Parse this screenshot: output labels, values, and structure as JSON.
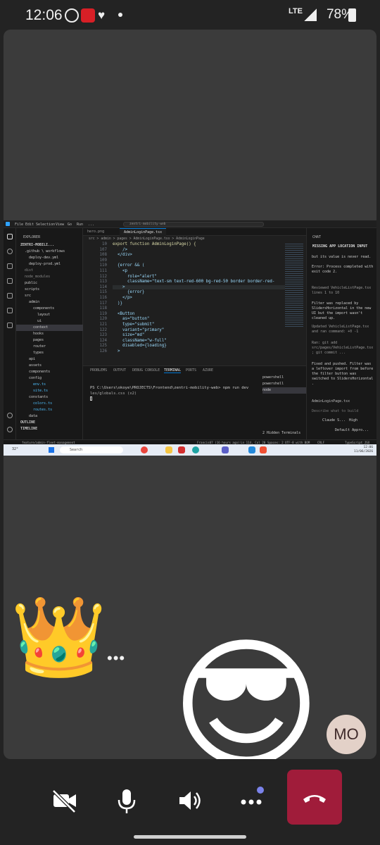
{
  "status_bar": {
    "time": "12:06",
    "network": "LTE",
    "battery": "78%",
    "icons": [
      "whatsapp-icon",
      "smart-cash-icon",
      "heart-icon",
      "dot-icon",
      "lte-icon",
      "signal-icon",
      "battery-icon"
    ]
  },
  "vscode": {
    "menu": [
      "File",
      "Edit",
      "Selection",
      "View",
      "Go",
      "Run",
      "..."
    ],
    "search_placeholder": "zentri-mobility-web",
    "explorer": {
      "title": "EXPLORER",
      "project": "ZENTRI-MOBILI...",
      "items": [
        ".github \\ workflows",
        "deploy-dev.yml",
        "deploy-prod.yml",
        "dist",
        "node_modules",
        "public",
        "scripts",
        "src",
        "admin",
        "components",
        "layout",
        "ui",
        "context",
        "hooks",
        "pages",
        "router",
        "types",
        "api",
        "assets",
        "components",
        "config",
        "env.ts",
        "site.ts",
        "constants",
        "colors.ts",
        "routes.ts",
        "data"
      ],
      "sections": [
        "OUTLINE",
        "TIMELINE"
      ]
    },
    "tabs": [
      "hero.png",
      "AdminLoginPage.tsx"
    ],
    "breadcrumb": "src > admin > pages > AdminLoginPage.tsx > AdminLoginPage",
    "code": [
      {
        "n": "10",
        "t": "export function AdminLoginPage() {"
      },
      {
        "n": "107",
        "t": "    />"
      },
      {
        "n": "108",
        "t": "  </div>"
      },
      {
        "n": "109",
        "t": ""
      },
      {
        "n": "110",
        "t": "  {error && ("
      },
      {
        "n": "111",
        "t": "    <p"
      },
      {
        "n": "112",
        "t": "      role=\"alert\""
      },
      {
        "n": "113",
        "t": "      className=\"text-sm text-red-600 bg-red-50 border border-red-"
      },
      {
        "n": "114",
        "t": "    >"
      },
      {
        "n": "115",
        "t": "      {error}"
      },
      {
        "n": "116",
        "t": "    </p>"
      },
      {
        "n": "117",
        "t": "  )}"
      },
      {
        "n": "118",
        "t": ""
      },
      {
        "n": "119",
        "t": "  <Button"
      },
      {
        "n": "120",
        "t": "    as=\"button\""
      },
      {
        "n": "121",
        "t": "    type=\"submit\""
      },
      {
        "n": "122",
        "t": "    variant=\"primary\""
      },
      {
        "n": "123",
        "t": "    size=\"md\""
      },
      {
        "n": "124",
        "t": "    className=\"w-full\""
      },
      {
        "n": "125",
        "t": "    disabled={loading}"
      },
      {
        "n": "126",
        "t": "  >"
      }
    ],
    "panel_tabs": [
      "PROBLEMS",
      "OUTPUT",
      "DEBUG CONSOLE",
      "TERMINAL",
      "PORTS",
      "AZURE"
    ],
    "terminal": [
      "PS C:\\Users\\okoye\\PROJECTS\\Frontend\\zentri-mobility-web> npm run dev",
      "les/globals.css (x2)"
    ],
    "terminals": [
      "powershell",
      "powershell",
      "node"
    ],
    "hidden_terminals": "2 Hidden Terminals",
    "chat": {
      "header": "CHAT",
      "title": "MISSING APP LOCATION INPUT",
      "messages": [
        "but its value is never read.",
        "Error: Process completed with exit code 2.",
        "Reviewed VehicleListPage.tsx lines 1 to 10",
        "Filter was replaced by SlidersHorizontal in the new UI but the import wasn't cleaned up.",
        "Updated VehicleListPage.tsx and ran command: +0 -1",
        "Ran: git add src/pages/VehicleListPage.tsx ; git commit ...",
        "Fixed and pushed. Filter was a leftover import from before the filter button was switched to SlidersHorizontal ."
      ],
      "file_chip": "AdminLoginPage.tsx",
      "input_placeholder": "Describe what to build",
      "model": "Claude S...",
      "mode": "High",
      "footer": "Default Appro..."
    },
    "statusbar": {
      "branch": "feature/admin-fleet-management",
      "author": "Francis07 (16 hours ago)",
      "position": "Ln 114, Col 20",
      "spaces": "Spaces: 2",
      "encoding": "UTF-8 with BOM",
      "eol": "CRLF",
      "language": "TypeScript JSX"
    }
  },
  "taskbar": {
    "weather": "32°",
    "search": "Search",
    "time": "12:06",
    "date": "11/06/2026"
  },
  "call": {
    "participant_initials": "MO",
    "controls": [
      "camera-off-icon",
      "microphone-icon",
      "speaker-icon",
      "more-icon",
      "hang-up-icon"
    ]
  },
  "colors": {
    "background": "#232323",
    "video_tile": "#3b3b3b",
    "hangup": "#a01c3a",
    "avatar": "#e3d1c8"
  }
}
